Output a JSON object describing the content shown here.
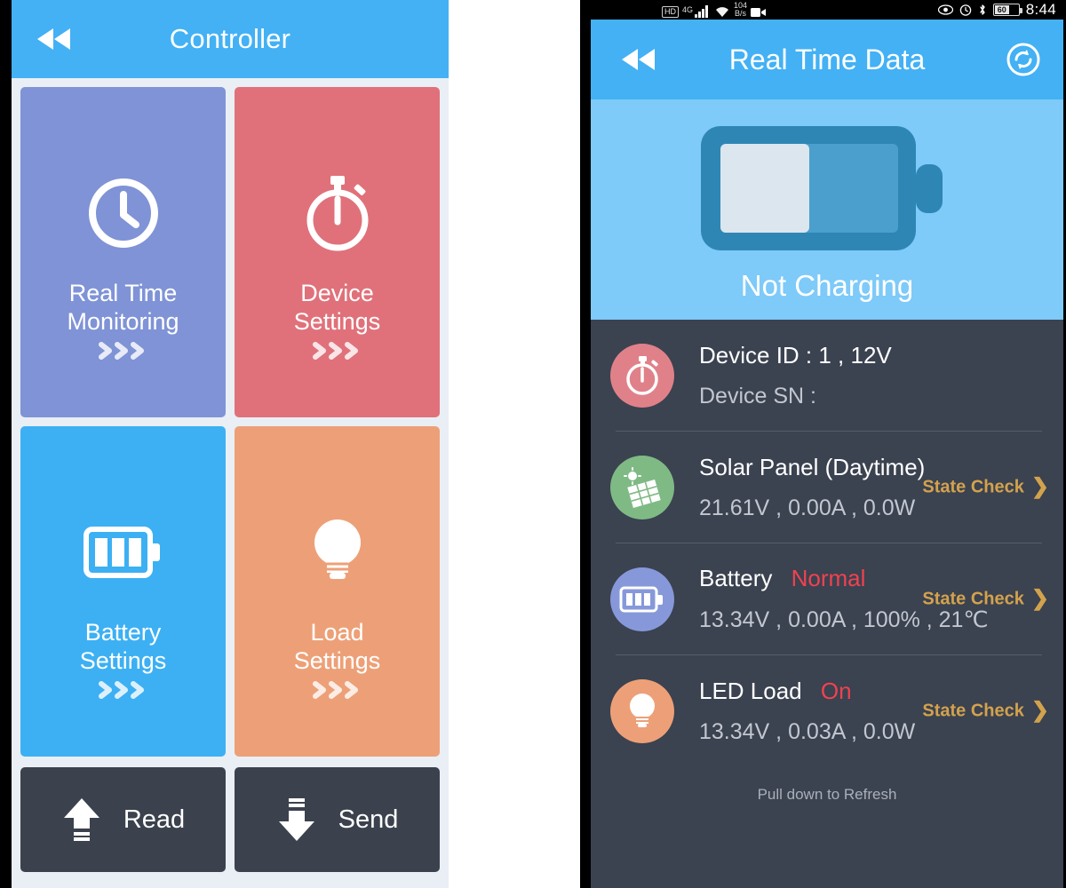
{
  "left": {
    "appbar": {
      "title": "Controller",
      "back_icon": "rewind-back-icon"
    },
    "tiles": [
      {
        "label_line1": "Real Time",
        "label_line2": "Monitoring",
        "icon": "clock-icon",
        "color": "#7f93d6"
      },
      {
        "label_line1": "Device",
        "label_line2": "Settings",
        "icon": "stopwatch-icon",
        "color": "#e0717a"
      },
      {
        "label_line1": "Battery",
        "label_line2": "Settings",
        "icon": "battery-icon",
        "color": "#3cb0f3"
      },
      {
        "label_line1": "Load",
        "label_line2": "Settings",
        "icon": "lightbulb-icon",
        "color": "#eda077"
      }
    ],
    "buttons": [
      {
        "label": "Read",
        "icon": "upload-arrow-icon"
      },
      {
        "label": "Send",
        "icon": "download-arrow-icon"
      }
    ]
  },
  "right": {
    "statusbar": {
      "hd_badge": "HD",
      "network_type": "4G",
      "signal_icon": "signal-bars-icon",
      "wifi_icon": "wifi-icon",
      "data_rate_value": "104",
      "data_rate_unit": "B/s",
      "screen_record_icon": "video-camera-icon",
      "eye_icon": "eye-icon",
      "alarm_icon": "alarm-clock-icon",
      "bluetooth_icon": "bluetooth-icon",
      "battery_percent": "60",
      "clock": "8:44"
    },
    "appbar": {
      "title": "Real Time Data",
      "back_icon": "rewind-back-icon",
      "refresh_icon": "refresh-sync-icon"
    },
    "hero": {
      "icon": "battery-half-icon",
      "caption": "Not Charging",
      "bg_color": "#7ecaf9",
      "fill_percent": 50
    },
    "rows": [
      {
        "avatar_icon": "stopwatch-icon",
        "avatar_color": "#e08189",
        "line1": "Device ID : 1 , 12V",
        "line2": "Device SN :",
        "status": "",
        "state_check": ""
      },
      {
        "avatar_icon": "solar-panel-icon",
        "avatar_color": "#7fba85",
        "line1": "Solar Panel  (Daytime)",
        "line2": "21.61V , 0.00A , 0.0W",
        "status": "",
        "state_check": "State Check"
      },
      {
        "avatar_icon": "battery-icon",
        "avatar_color": "#8798da",
        "line1": "Battery",
        "line2": "13.34V , 0.00A , 100% , 21℃",
        "status": "Normal",
        "state_check": "State Check"
      },
      {
        "avatar_icon": "lightbulb-icon",
        "avatar_color": "#eda077",
        "line1": "LED Load",
        "line2": "13.34V , 0.03A , 0.0W",
        "status": "On",
        "state_check": "State Check"
      }
    ],
    "pull_hint": "Pull down to Refresh"
  },
  "colors": {
    "appbar_blue": "#43b1f4",
    "hero_blue": "#7ecaf9",
    "list_dark": "#3b4250",
    "status_red": "#f0424f",
    "state_check_gold": "#d3a24d"
  }
}
